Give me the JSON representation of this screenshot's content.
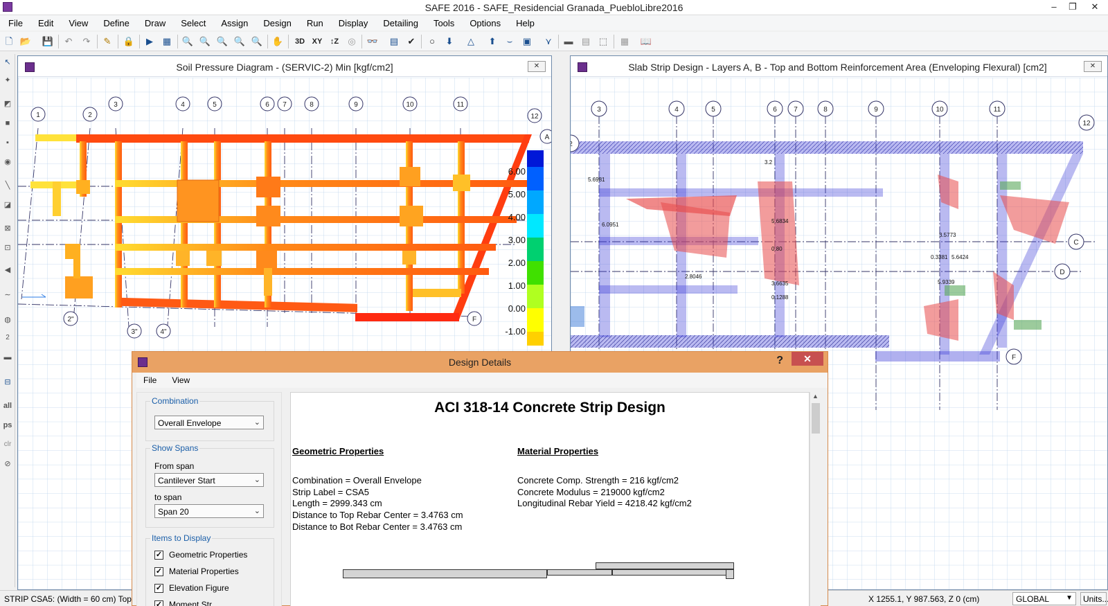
{
  "window": {
    "title": "SAFE 2016 - SAFE_Residencial Granada_PuebloLibre2016",
    "min": "–",
    "max": "❐",
    "close": "✕"
  },
  "menu": [
    "File",
    "Edit",
    "View",
    "Define",
    "Draw",
    "Select",
    "Assign",
    "Design",
    "Run",
    "Display",
    "Detailing",
    "Tools",
    "Options",
    "Help"
  ],
  "toolbar": {
    "view_3d": "3D",
    "view_xy": "XY",
    "view_z": "↕Z"
  },
  "left_window": {
    "title": "Soil Pressure Diagram - (SERVIC-2)  Min  [kgf/cm2]",
    "close": "✕",
    "grid_top": [
      "1",
      "2",
      "3",
      "4",
      "5",
      "6",
      "7",
      "8",
      "9",
      "10",
      "11",
      "12"
    ],
    "grid_bottom": [
      "2\"",
      "3\"",
      "4\""
    ],
    "grid_side": [
      "A",
      "F"
    ],
    "legend": [
      "6.00",
      "5.00",
      "4.00",
      "3.00",
      "2.00",
      "1.00",
      "0.00",
      "-1.00"
    ],
    "legend_colors": [
      "#0018d8",
      "#0060ff",
      "#00a8ff",
      "#00e8ff",
      "#00d070",
      "#40e000",
      "#b0ff20",
      "#ffff00",
      "#ffd000"
    ]
  },
  "right_window": {
    "title": "Slab Strip Design - Layers A, B - Top and Bottom Reinforcement Area (Enveloping Flexural) [cm2]",
    "close": "✕",
    "grid_top": [
      "2",
      "3",
      "4",
      "5",
      "6",
      "7",
      "8",
      "9",
      "10",
      "11",
      "12"
    ],
    "grid_side": [
      "C",
      "D",
      "F"
    ]
  },
  "dialog": {
    "title": "Design Details",
    "help": "?",
    "close": "✕",
    "menu": [
      "File",
      "View"
    ],
    "combination": {
      "label": "Combination",
      "value": "Overall Envelope"
    },
    "show_spans": {
      "label": "Show Spans",
      "from_label": "From span",
      "from_value": "Cantilever Start",
      "to_label": "to span",
      "to_value": "Span 20"
    },
    "items": {
      "label": "Items to Display",
      "list": [
        "Geometric Properties",
        "Material Properties",
        "Elevation Figure",
        "Moment Str"
      ]
    },
    "report": {
      "title": "ACI 318-14 Concrete Strip Design",
      "geo_heading": "Geometric Properties",
      "geo_lines": [
        "Combination = Overall Envelope",
        "Strip Label = CSA5",
        "Length = 2999.343 cm",
        "Distance to Top Rebar Center = 3.4763 cm",
        "Distance to Bot Rebar Center = 3.4763 cm"
      ],
      "mat_heading": "Material Properties",
      "mat_lines": [
        "Concrete Comp. Strength = 216 kgf/cm2",
        "Concrete Modulus = 219000 kgf/cm2",
        "Longitudinal Rebar Yield = 4218.42 kgf/cm2"
      ]
    }
  },
  "statusbar": {
    "left": "STRIP CSA5:  (Width = 60 cm)  Top",
    "coords": "X 1255.1,  Y 987.563,  Z 0  (cm)",
    "coord_system": "GLOBAL",
    "units": "Units..."
  }
}
